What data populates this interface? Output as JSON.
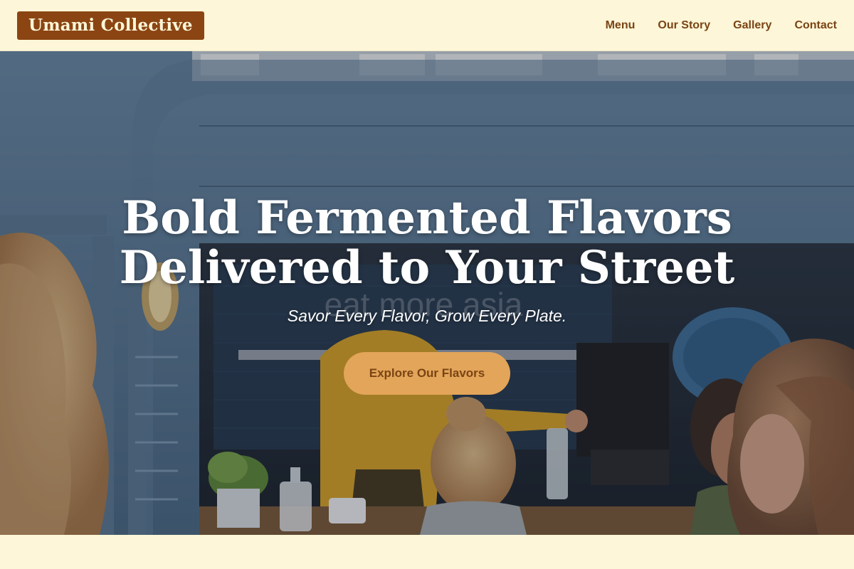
{
  "header": {
    "logo_text": "Umami Collective",
    "nav": [
      {
        "label": "Menu"
      },
      {
        "label": "Our Story"
      },
      {
        "label": "Gallery"
      },
      {
        "label": "Contact"
      }
    ]
  },
  "hero": {
    "title_line1": "Bold Fermented Flavors",
    "title_line2": "Delivered to Your Street",
    "subtitle": "Savor Every Flavor, Grow Every Plate.",
    "cta_label": "Explore Our Flavors",
    "background_sign_text": "eat more asia"
  },
  "colors": {
    "page_bg": "#fdf6d8",
    "logo_bg": "#8b4513",
    "nav_text": "#7a4414",
    "cta_bg": "#e3a559",
    "cta_text": "#7a4414"
  }
}
